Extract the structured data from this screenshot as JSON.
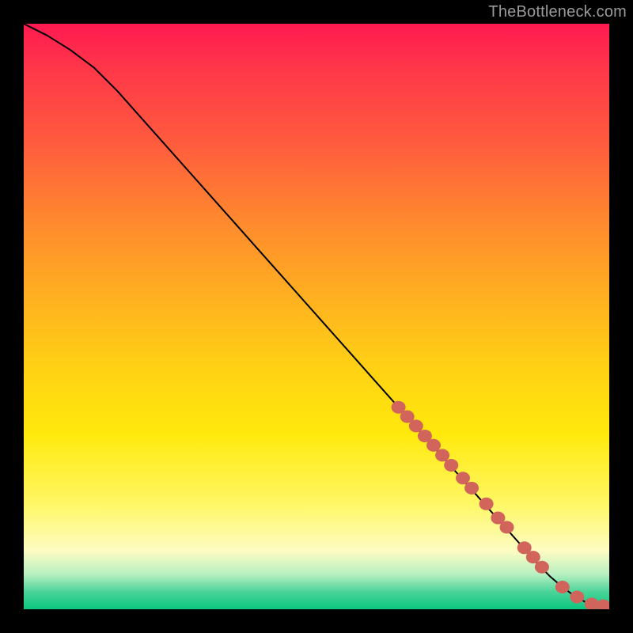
{
  "attribution": "TheBottleneck.com",
  "colors": {
    "marker": "#d1645b",
    "curve": "#000000"
  },
  "chart_data": {
    "type": "line",
    "title": "",
    "xlabel": "",
    "ylabel": "",
    "xlim": [
      0,
      100
    ],
    "ylim": [
      0,
      100
    ],
    "series": [
      {
        "name": "curve",
        "x": [
          0,
          4,
          8,
          12,
          16,
          20,
          24,
          28,
          32,
          36,
          40,
          44,
          48,
          52,
          56,
          60,
          64,
          68,
          72,
          76,
          80,
          84,
          88,
          90,
          92,
          94,
          96,
          98,
          100
        ],
        "y": [
          100,
          98,
          95.5,
          92.5,
          88.5,
          84,
          79.5,
          75,
          70.5,
          66,
          61.5,
          57,
          52.5,
          48,
          43.5,
          39,
          34.5,
          30,
          25.5,
          21,
          16.5,
          12,
          7.5,
          5.5,
          3.8,
          2.3,
          1.2,
          0.6,
          0.5
        ]
      }
    ],
    "markers": {
      "name": "highlighted-points",
      "x": [
        64,
        65.5,
        67,
        68.5,
        70,
        71.5,
        73,
        75,
        76.5,
        79,
        81,
        82.5,
        85.5,
        87,
        88.5,
        92,
        94.5,
        97,
        99
      ],
      "y": [
        34.5,
        32.9,
        31.3,
        29.6,
        28.0,
        26.3,
        24.6,
        22.4,
        20.7,
        18.0,
        15.6,
        14.0,
        10.5,
        8.9,
        7.2,
        3.8,
        2.1,
        0.9,
        0.6
      ]
    }
  }
}
